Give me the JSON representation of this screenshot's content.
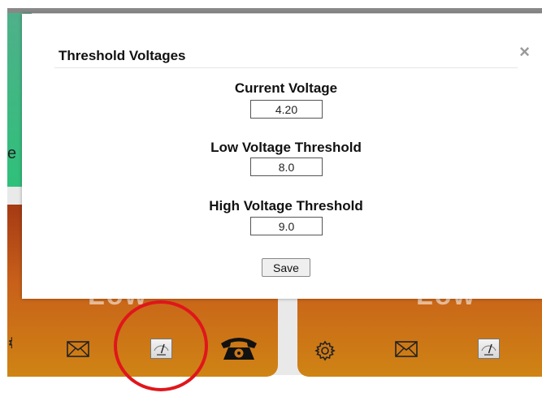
{
  "dialog": {
    "title": "Threshold Voltages",
    "close_glyph": "×",
    "fields": [
      {
        "label": "Current Voltage",
        "value": "4.20"
      },
      {
        "label": "Low Voltage Threshold",
        "value": "8.0"
      },
      {
        "label": "High Voltage Threshold",
        "value": "9.0"
      }
    ],
    "save_label": "Save"
  },
  "background": {
    "tiles": [
      {
        "status": "Low",
        "icons": [
          "settings-icon",
          "mail-icon",
          "meter-icon",
          "phone-icon"
        ]
      },
      {
        "status": "Low",
        "icons": [
          "settings-icon",
          "mail-icon",
          "meter-icon"
        ]
      }
    ],
    "green_tile_char": "e",
    "highlight_color": "#e0161c"
  }
}
